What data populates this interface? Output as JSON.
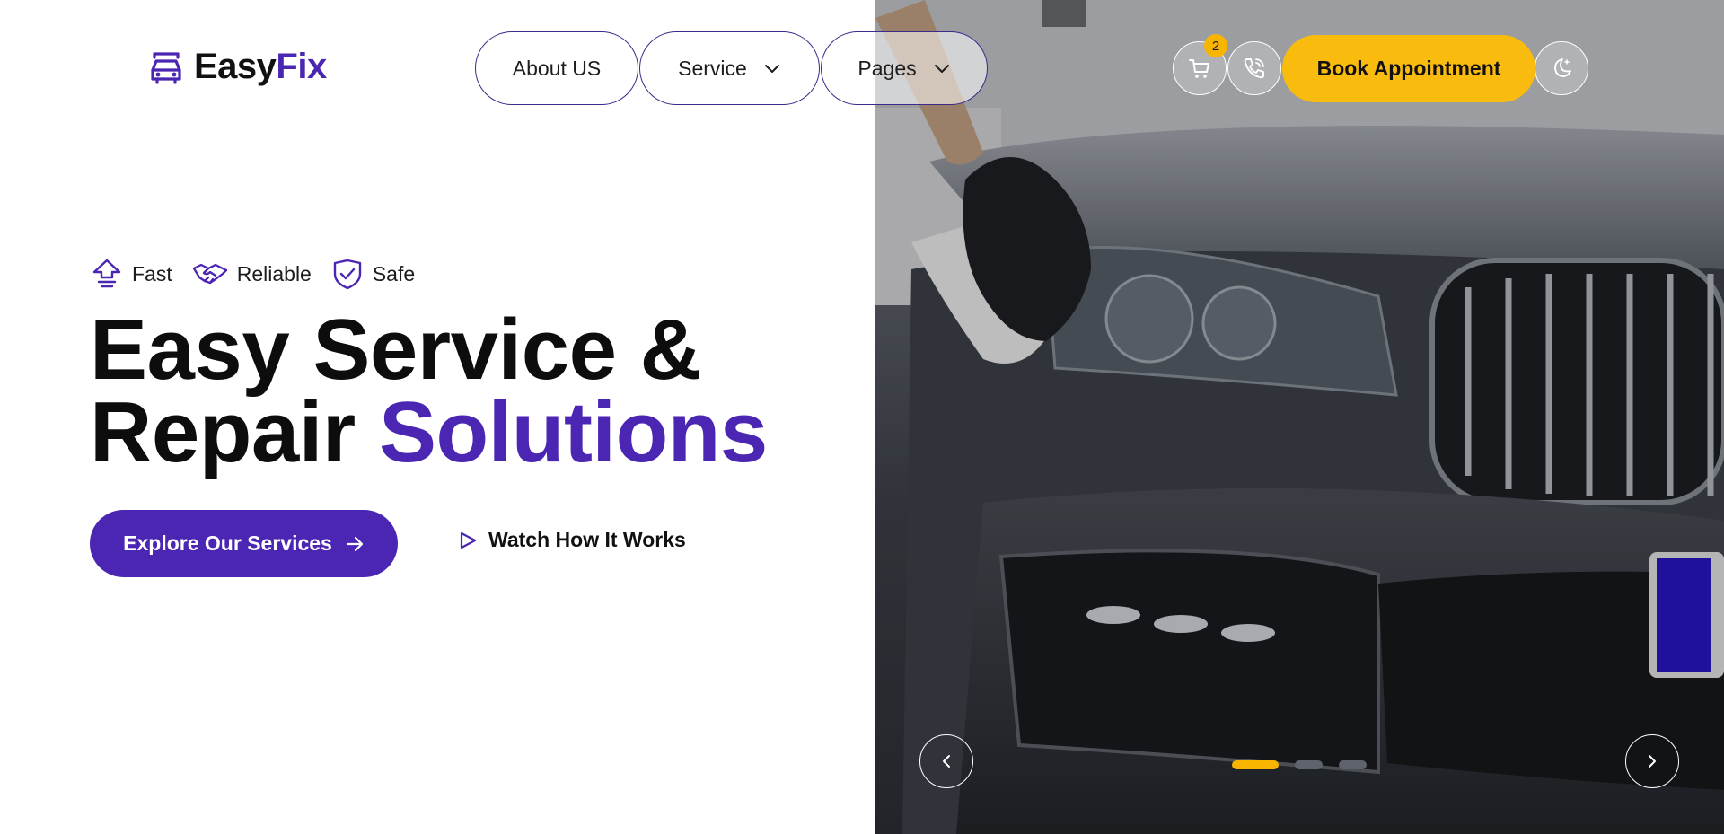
{
  "brand": {
    "name_part1": "Easy",
    "name_part2": "Fix"
  },
  "nav": {
    "items": [
      {
        "label": "About US"
      },
      {
        "label": "Service"
      },
      {
        "label": "Pages"
      }
    ]
  },
  "header": {
    "cart_count": "2",
    "book_label": "Book Appointment",
    "icons": [
      "cart-icon",
      "phone-icon",
      "moon-icon"
    ]
  },
  "hero": {
    "features": [
      {
        "label": "Fast",
        "icon": "fast-upload-icon"
      },
      {
        "label": "Reliable",
        "icon": "handshake-icon"
      },
      {
        "label": "Safe",
        "icon": "shield-check-icon"
      }
    ],
    "headline_line1": "Easy Service &",
    "headline_line2_plain": "Repair ",
    "headline_line2_accent": "Solutions",
    "cta_primary": "Explore Our Services",
    "cta_secondary": "Watch How It Works"
  },
  "slider": {
    "slide_count": 3,
    "active_index": 0
  },
  "colors": {
    "primary": "#4b26b3",
    "accent": "#f9bb0e",
    "text": "#111111"
  }
}
